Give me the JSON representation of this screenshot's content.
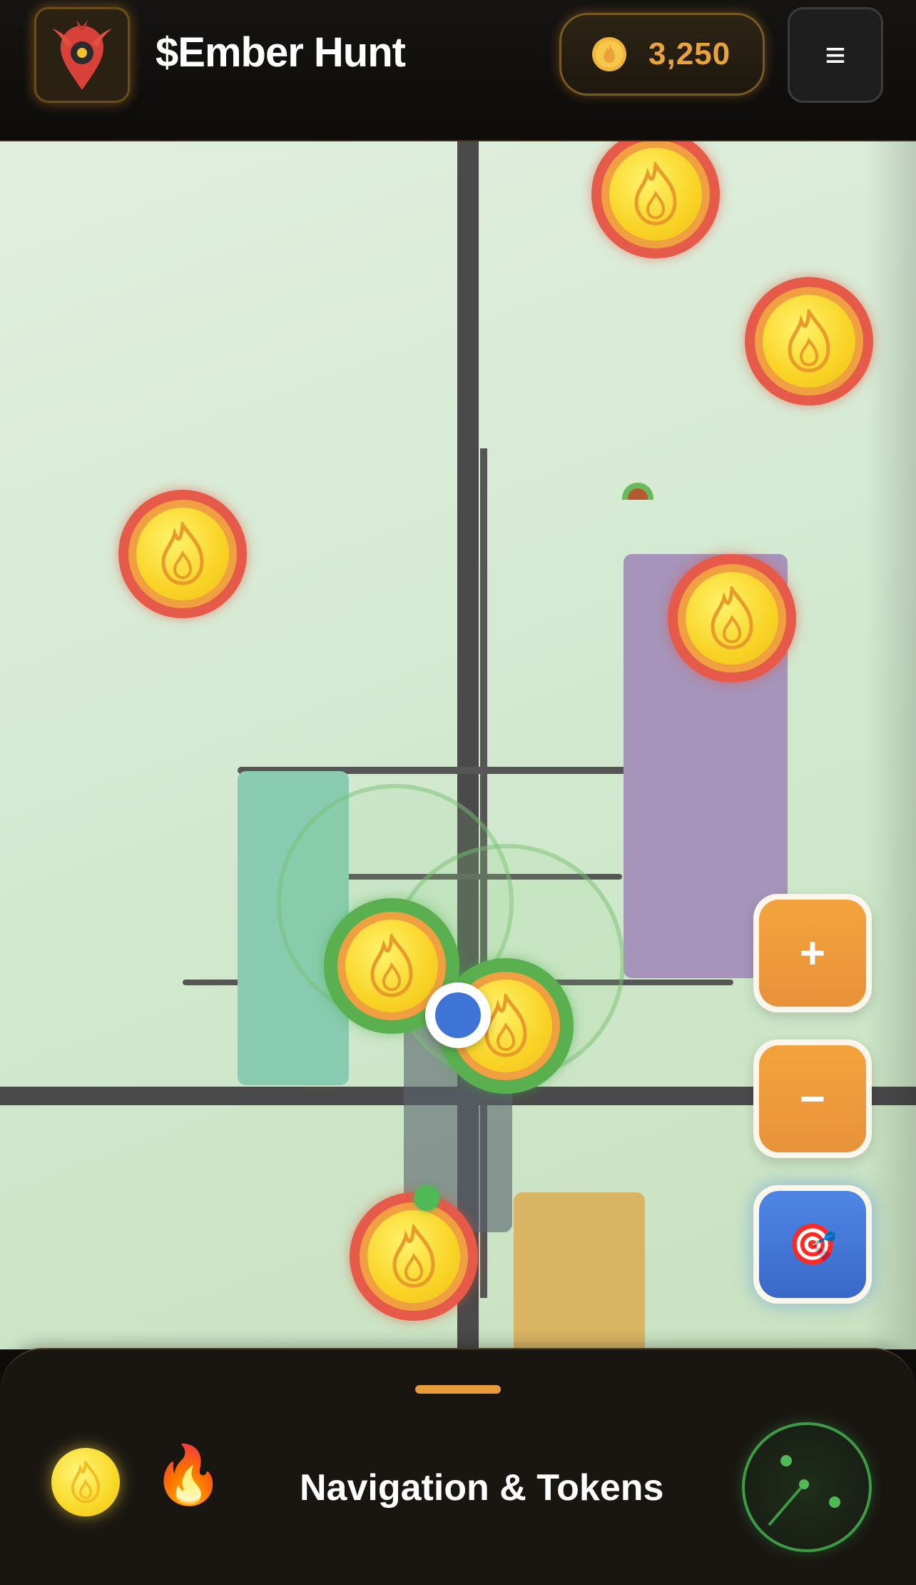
{
  "app": {
    "title": "$Ember Hunt",
    "logo_icon": "phoenix-pin-icon"
  },
  "header": {
    "balance": "3,250",
    "balance_icon": "flame-coin-icon",
    "menu_label": "≡"
  },
  "map": {
    "tokens": [
      {
        "state": "out-of-range",
        "icon": "flame-icon"
      },
      {
        "state": "out-of-range",
        "icon": "flame-icon"
      },
      {
        "state": "out-of-range",
        "icon": "flame-icon"
      },
      {
        "state": "out-of-range",
        "icon": "flame-icon"
      },
      {
        "state": "in-range",
        "icon": "flame-icon"
      },
      {
        "state": "in-range",
        "icon": "flame-icon"
      },
      {
        "state": "out-of-range",
        "icon": "flame-icon"
      }
    ],
    "user_location_icon": "user-location-dot"
  },
  "controls": {
    "zoom_in_label": "+",
    "zoom_out_label": "−",
    "recenter_label": "🎯"
  },
  "sheet": {
    "title": "Navigation & Tokens",
    "flame_glyph": "🔥",
    "radar_icon": "radar-icon"
  },
  "colors": {
    "accent": "#e89b3a",
    "token_out_of_range": "#e65a4a",
    "token_in_range": "#5ab04e",
    "user": "#3d74d6",
    "header_bg": "#0f0e0c"
  }
}
